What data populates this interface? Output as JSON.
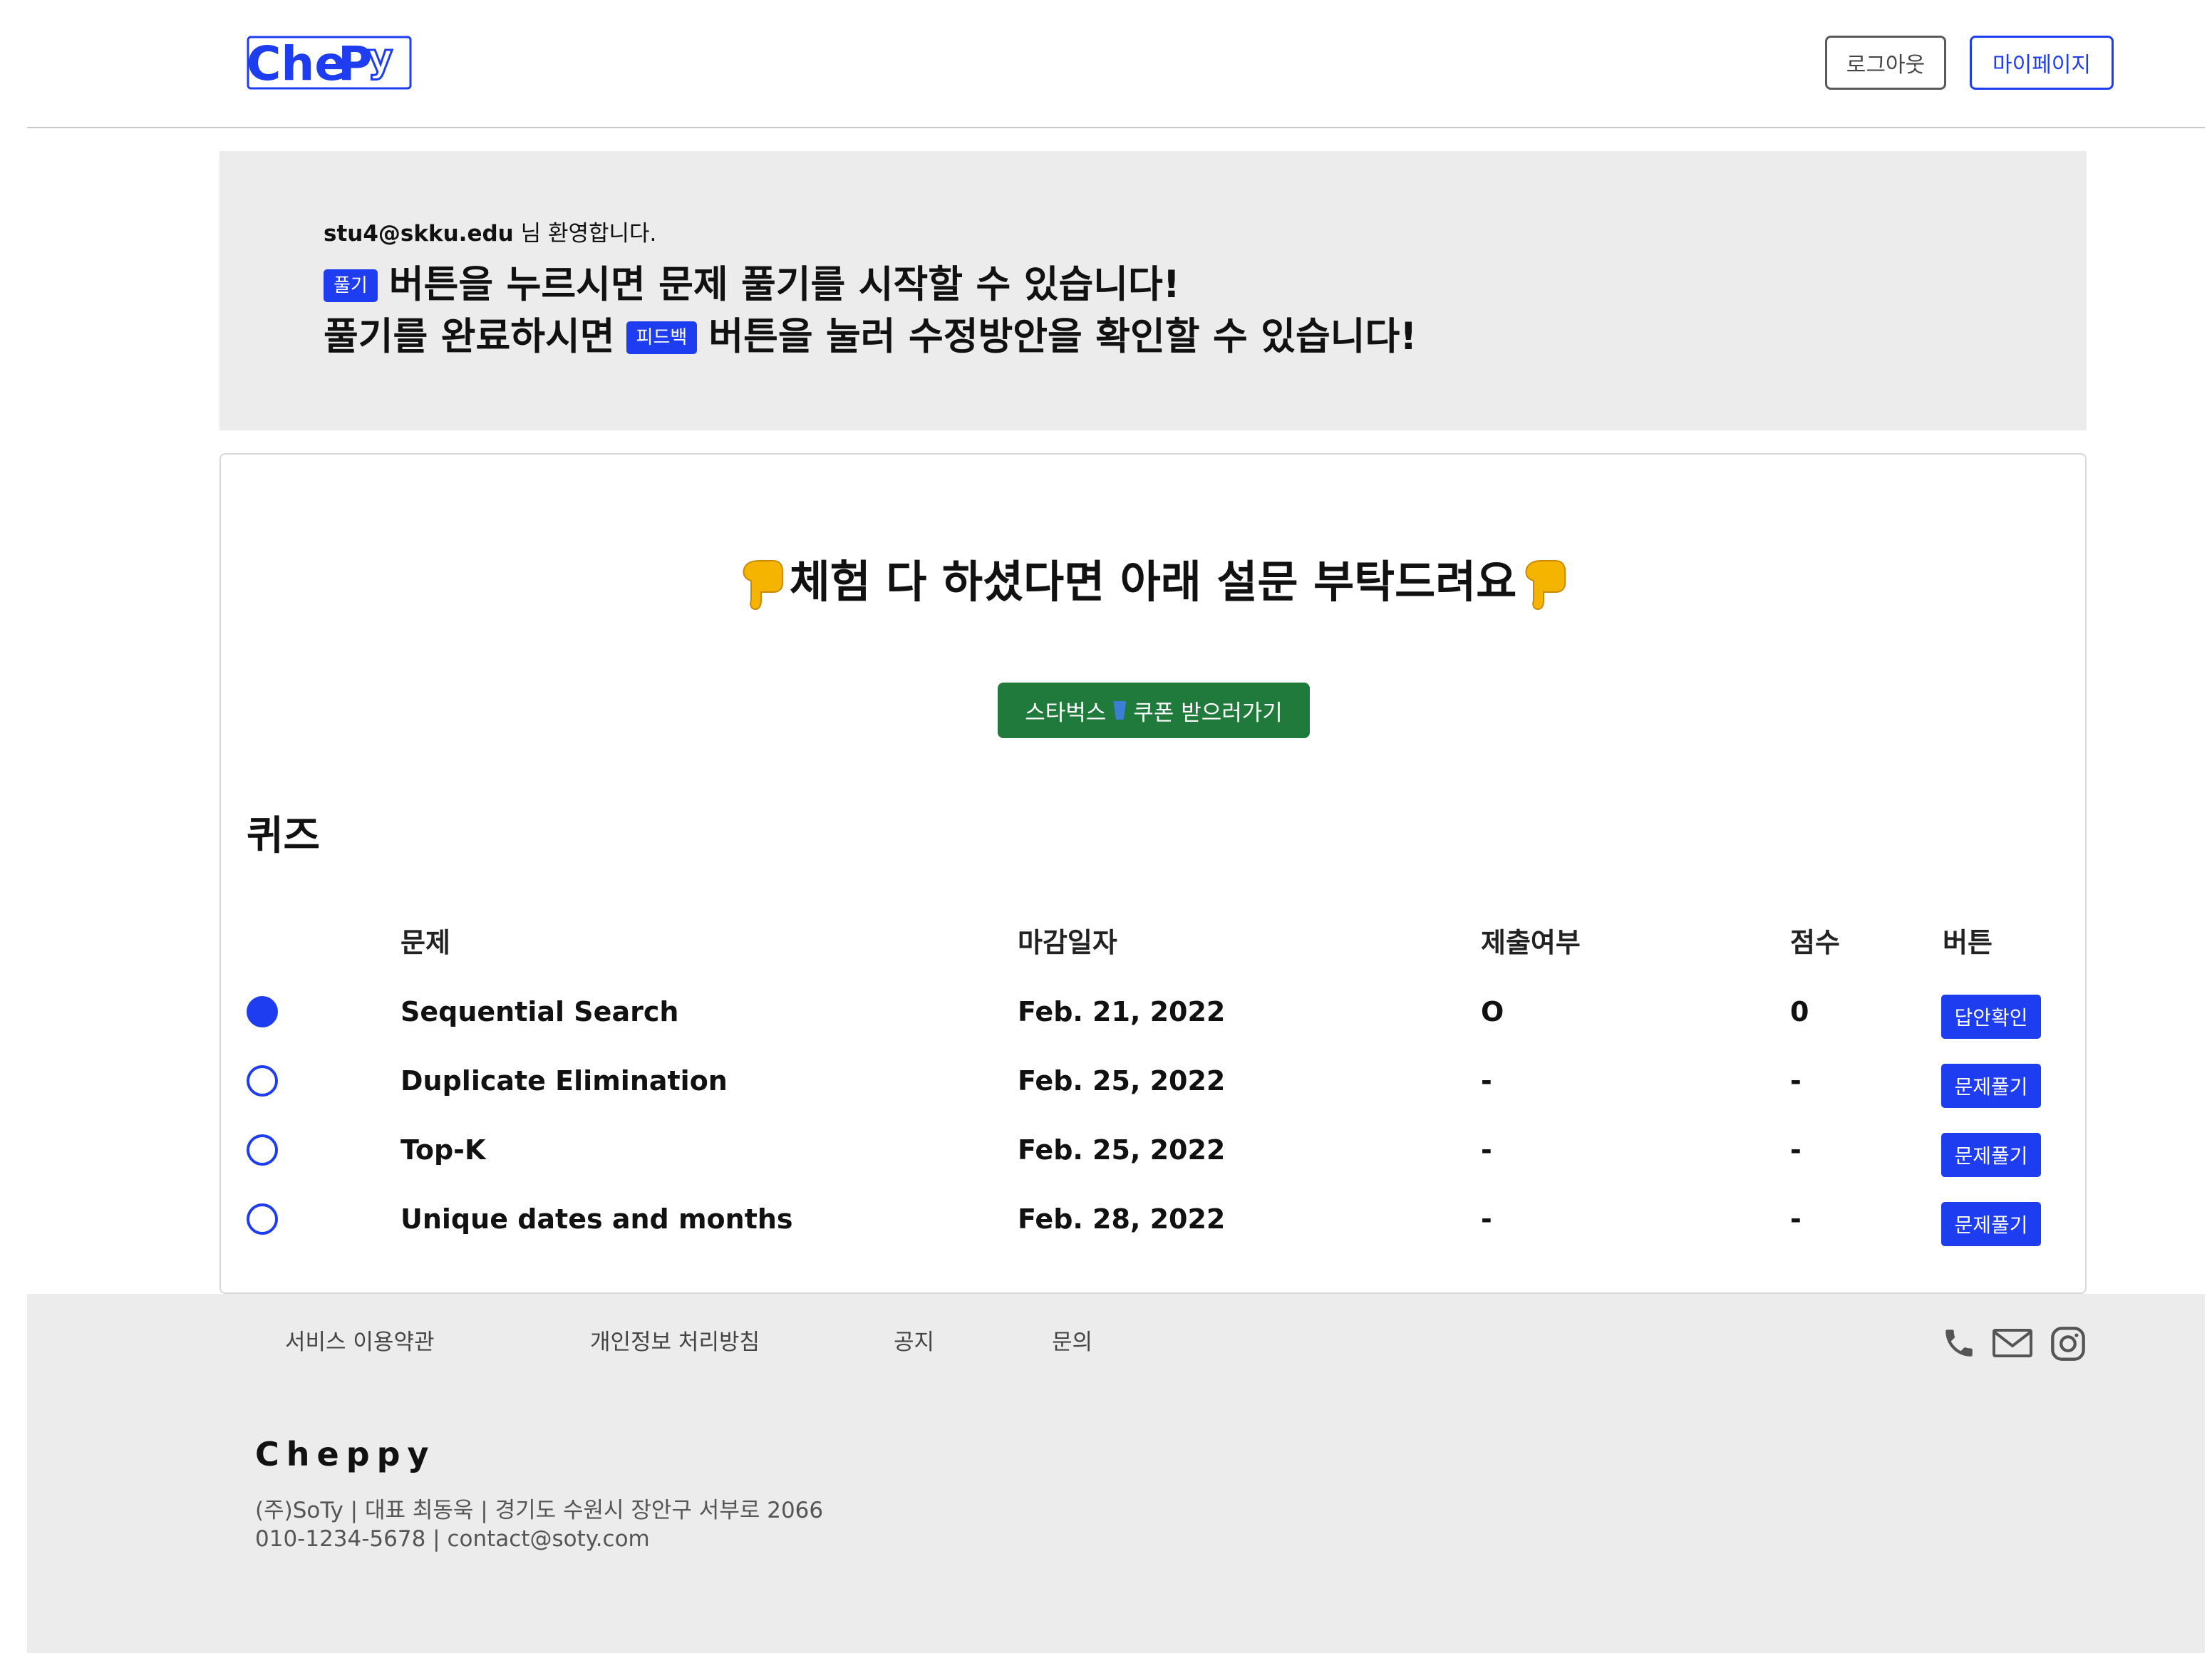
{
  "header": {
    "logo_text": "Cheppy",
    "logout_label": "로그아웃",
    "mypage_label": "마이페이지"
  },
  "banner": {
    "user_email": "stu4@skku.edu",
    "welcome_suffix": " 님 환영합니다.",
    "solve_badge": "풀기",
    "line1_text": "버튼을 누르시면 문제 풀기를 시작할 수 있습니다!",
    "line2_prefix": "풀기를 완료하시면",
    "feedback_badge": "피드백",
    "line2_suffix": "버튼을 눌러 수정방안을 확인할 수 있습니다!"
  },
  "survey": {
    "title": "체험 다 하셨다면 아래 설문 부탁드려요",
    "coupon_before": "스타벅스",
    "coupon_after": "쿠폰 받으러가기"
  },
  "quiz": {
    "title": "퀴즈",
    "columns": {
      "problem": "문제",
      "deadline": "마감일자",
      "submitted": "제출여부",
      "score": "점수",
      "button": "버튼"
    },
    "rows": [
      {
        "selected": true,
        "problem": "Sequential Search",
        "deadline": "Feb. 21, 2022",
        "submitted": "O",
        "score": "0",
        "button": "답안확인"
      },
      {
        "selected": false,
        "problem": "Duplicate Elimination",
        "deadline": "Feb. 25, 2022",
        "submitted": "-",
        "score": "-",
        "button": "문제풀기"
      },
      {
        "selected": false,
        "problem": "Top-K",
        "deadline": "Feb. 25, 2022",
        "submitted": "-",
        "score": "-",
        "button": "문제풀기"
      },
      {
        "selected": false,
        "problem": "Unique dates and months",
        "deadline": "Feb. 28, 2022",
        "submitted": "-",
        "score": "-",
        "button": "문제풀기"
      }
    ]
  },
  "footer": {
    "links": [
      "서비스 이용약관",
      "개인정보 처리방침",
      "공지",
      "문의"
    ],
    "icons": [
      "phone-icon",
      "mail-icon",
      "instagram-icon"
    ],
    "brand": "Cheppy",
    "company_line": "(주)SoTy | 대표 최동욱 | 경기도 수원시 장안구 서부로 2066",
    "contact_line": "010-1234-5678 | contact@soty.com"
  },
  "colors": {
    "primary": "#1f3df0",
    "success": "#1f7a3c",
    "banner_bg": "#ececec"
  }
}
